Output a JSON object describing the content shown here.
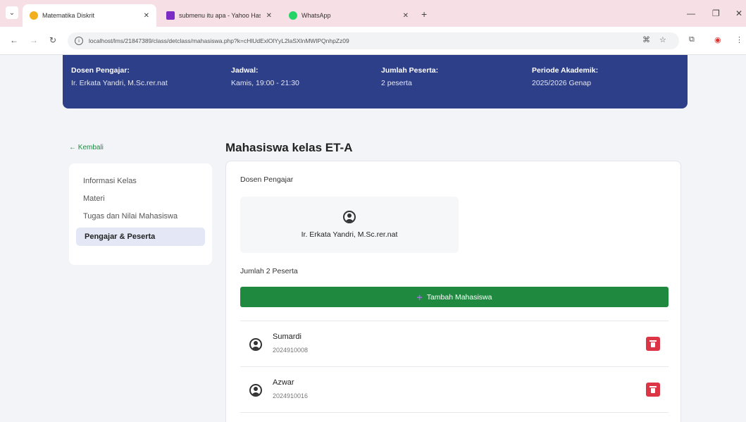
{
  "browser": {
    "tabs": [
      {
        "title": "Matematika Diskrit",
        "active": true,
        "icon_color": "#f2b01e",
        "icon": "moodle-icon"
      },
      {
        "title": "submenu itu apa - Yahoo Hasil",
        "active": false,
        "icon_color": "#7b2cc4",
        "icon": "yahoo-icon"
      },
      {
        "title": "WhatsApp",
        "active": false,
        "icon_color": "#25d366",
        "icon": "whatsapp-icon"
      }
    ],
    "url": "localhost/lms/21847389/class/detclass/mahasiswa.php?k=cHlUdExlOlYyL2laSXlnMWlPQnhpZz09"
  },
  "banner": {
    "dosen_label": "Dosen Pengajar:",
    "dosen_value": "Ir. Erkata Yandri, M.Sc.rer.nat",
    "jadwal_label": "Jadwal:",
    "jadwal_value": "Kamis, 19:00 - 21:30",
    "peserta_label": "Jumlah Peserta:",
    "peserta_value": "2 peserta",
    "periode_label": "Periode Akademik:",
    "periode_value": "2025/2026 Genap"
  },
  "back_label": "← Kembali",
  "sidebar": {
    "items": [
      {
        "label": "Informasi Kelas",
        "active": false
      },
      {
        "label": "Materi",
        "active": false
      },
      {
        "label": "Tugas dan Nilai Mahasiswa",
        "active": false
      },
      {
        "label": "Pengajar & Peserta",
        "active": true
      }
    ]
  },
  "main": {
    "title": "Mahasiswa kelas ET-A",
    "dosen_section_label": "Dosen Pengajar",
    "dosen_name": "Ir. Erkata Yandri, M.Sc.rer.nat",
    "peserta_count_label": "Jumlah 2 Peserta",
    "add_button_label": "Tambah Mahasiswa",
    "students": [
      {
        "name": "Sumardi",
        "nim": "2024910008"
      },
      {
        "name": "Azwar",
        "nim": "2024910016"
      }
    ]
  },
  "colors": {
    "banner": "#2e3f89",
    "accent_green": "#1f8a3f",
    "delete_red": "#dc3545"
  }
}
